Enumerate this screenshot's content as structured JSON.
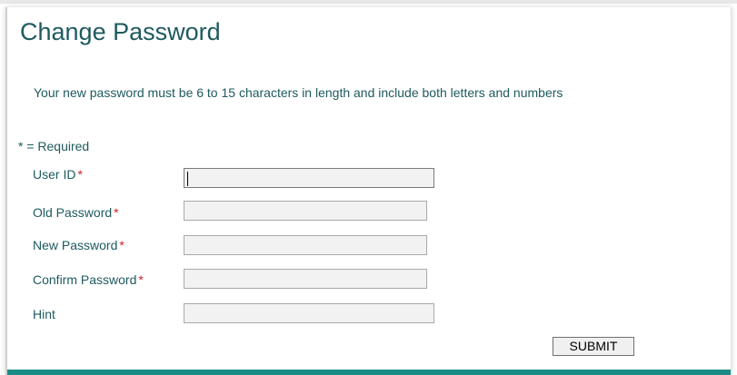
{
  "page": {
    "title": "Change Password",
    "instruction": "Your new password must be 6 to 15 characters in length and include both letters and numbers",
    "required_note": "* = Required",
    "required_marker": "*"
  },
  "form": {
    "fields": [
      {
        "label": "User ID",
        "required": true,
        "value": "",
        "focused": true
      },
      {
        "label": "Old Password",
        "required": true,
        "value": ""
      },
      {
        "label": "New Password",
        "required": true,
        "value": ""
      },
      {
        "label": "Confirm Password",
        "required": true,
        "value": ""
      },
      {
        "label": "Hint",
        "required": false,
        "value": ""
      }
    ],
    "submit_label": "SUBMIT"
  },
  "colors": {
    "text": "#1e5a5e",
    "required_asterisk": "#d0202a",
    "bottom_bar": "#1a8c85",
    "input_background": "#f2f2f2"
  }
}
